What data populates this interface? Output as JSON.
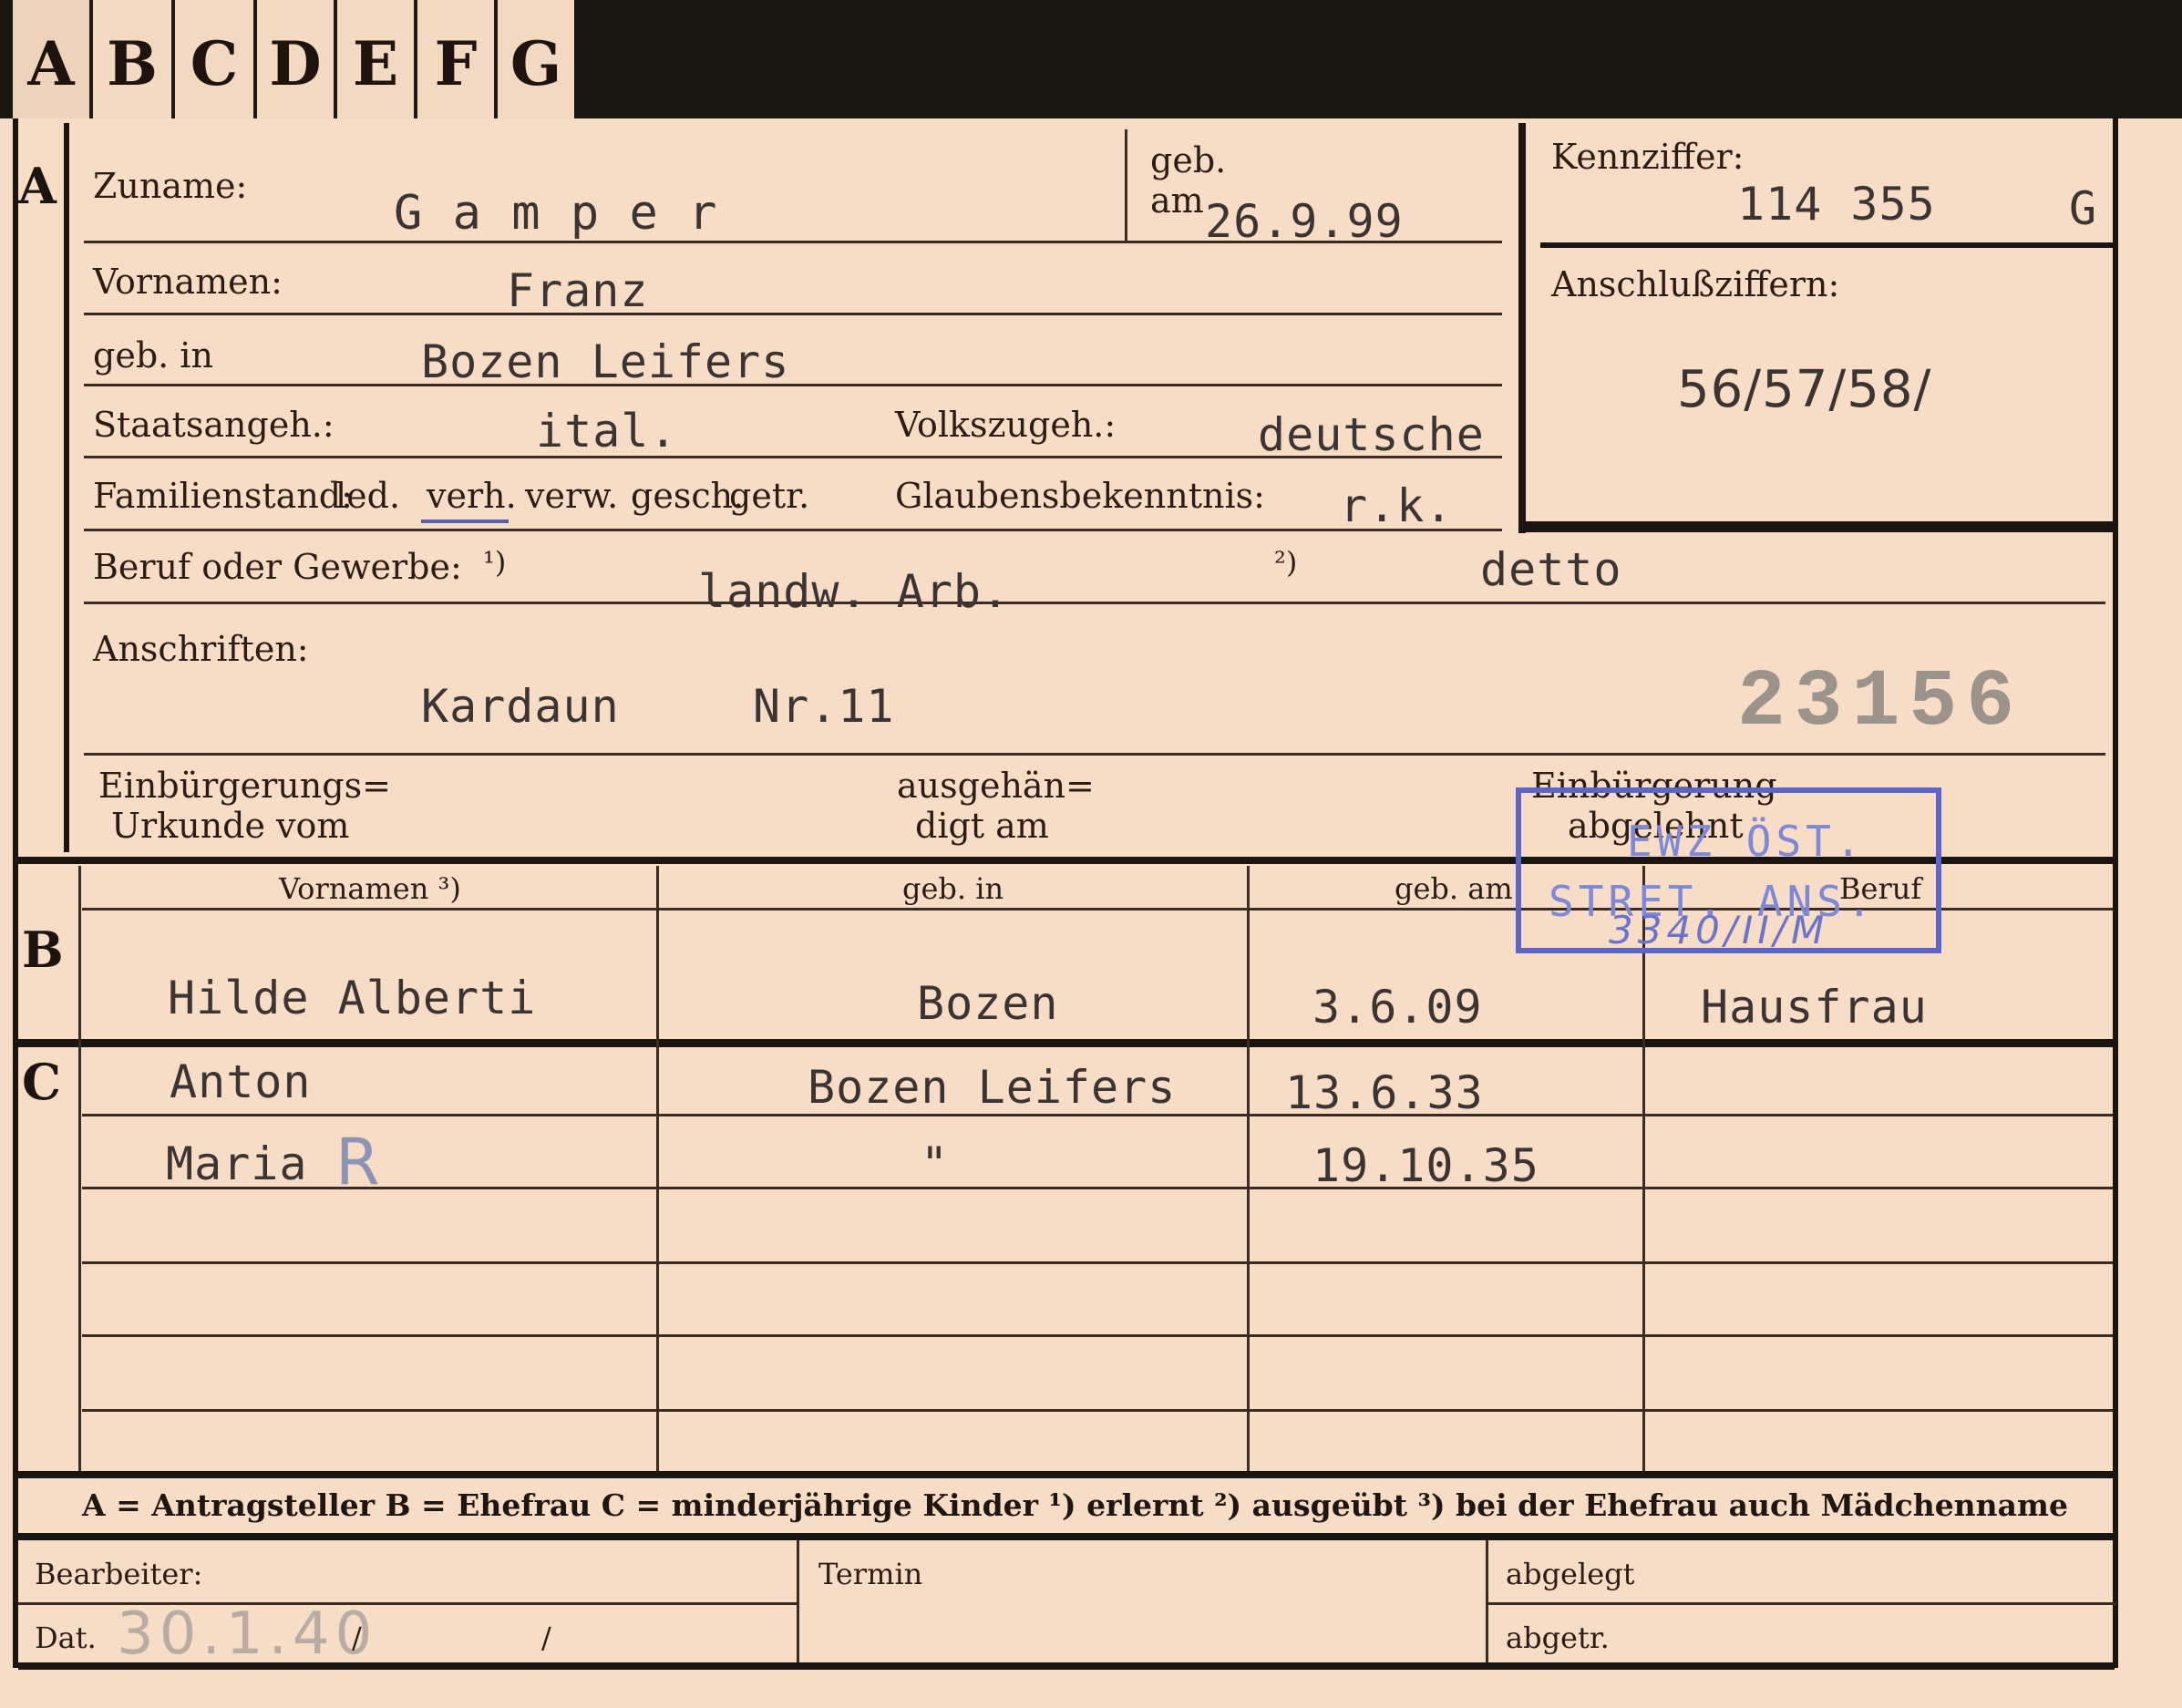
{
  "tabs": [
    "A",
    "B",
    "C",
    "D",
    "E",
    "F",
    "G"
  ],
  "section_letters": {
    "a": "A",
    "b": "B",
    "c": "C"
  },
  "applicant": {
    "surname_label": "Zuname:",
    "surname": "G a m p e r",
    "born_on_label_1": "geb.",
    "born_on_label_2": "am",
    "birth_date": "26.9.99",
    "given_names_label": "Vornamen:",
    "given_names": "Franz",
    "birthplace_label": "geb. in",
    "birthplace": "Bozen Leifers",
    "citizenship_label": "Staatsangeh.:",
    "citizenship": "ital.",
    "ethnicity_label": "Volkszugeh.:",
    "ethnicity": "deutsche",
    "marital_label": "Familienstand:",
    "marital_options": [
      "led.",
      "verh.",
      "verw.",
      "gesch.",
      "getr."
    ],
    "religion_label": "Glaubensbekenntnis:",
    "religion": "r.k.",
    "occupation_label": "Beruf oder Gewerbe:",
    "occupation_mark_1": "¹)",
    "occupation_learned": "landw. Arb.",
    "occupation_mark_2": "²)",
    "occupation_practised": "detto",
    "address_label": "Anschriften:",
    "address_place": "Kardaun",
    "address_number": "Nr.11",
    "file_number": "23156",
    "naturalization_cert_label_1": "Einbürgerungs=",
    "naturalization_cert_label_2": "Urkunde vom",
    "handed_out_label_1": "ausgehän=",
    "handed_out_label_2": "digt am",
    "naturalization_refused_label_1": "Einbürgerung",
    "naturalization_refused_label_2": "abgelehnt"
  },
  "reference": {
    "code_label": "Kennziffer:",
    "code": "114 355",
    "code_suffix": "G",
    "linked_label": "Anschlußziffern:",
    "linked": "56/57/58/"
  },
  "stamp": {
    "line1": "EWZ ÖST.",
    "line2": "STRET. ANS.",
    "handwritten": "3340/II/M"
  },
  "family_table": {
    "headers": [
      "Vornamen ³)",
      "geb. in",
      "geb. am",
      "Beruf"
    ],
    "wife": {
      "name": "Hilde Alberti",
      "birthplace": "Bozen",
      "birth_date": "3.6.09",
      "occupation": "Hausfrau"
    },
    "children": [
      {
        "name": "Anton",
        "birthplace": "Bozen Leifers",
        "birth_date": "13.6.33"
      },
      {
        "name": "Maria",
        "mark": "R",
        "birthplace": "\"",
        "birth_date": "19.10.35"
      }
    ]
  },
  "legend": "A = Antragsteller   B = Ehefrau   C = minderjährige Kinder   ¹) erlernt   ²) ausgeübt   ³) bei der Ehefrau auch Mädchenname",
  "footer": {
    "processor_label": "Bearbeiter:",
    "date_label": "Dat.",
    "date_value": "30.1.40",
    "slash1": "/",
    "slash2": "/",
    "deadline_label": "Termin",
    "filed_label": "abgelegt",
    "sent_label": "abgetr."
  },
  "colors": {
    "card": "#f7dcc6",
    "ink": "#2a1a12",
    "typewriter": "#3a3434",
    "stamp": "#5b66c8",
    "background": "#1a1612"
  }
}
